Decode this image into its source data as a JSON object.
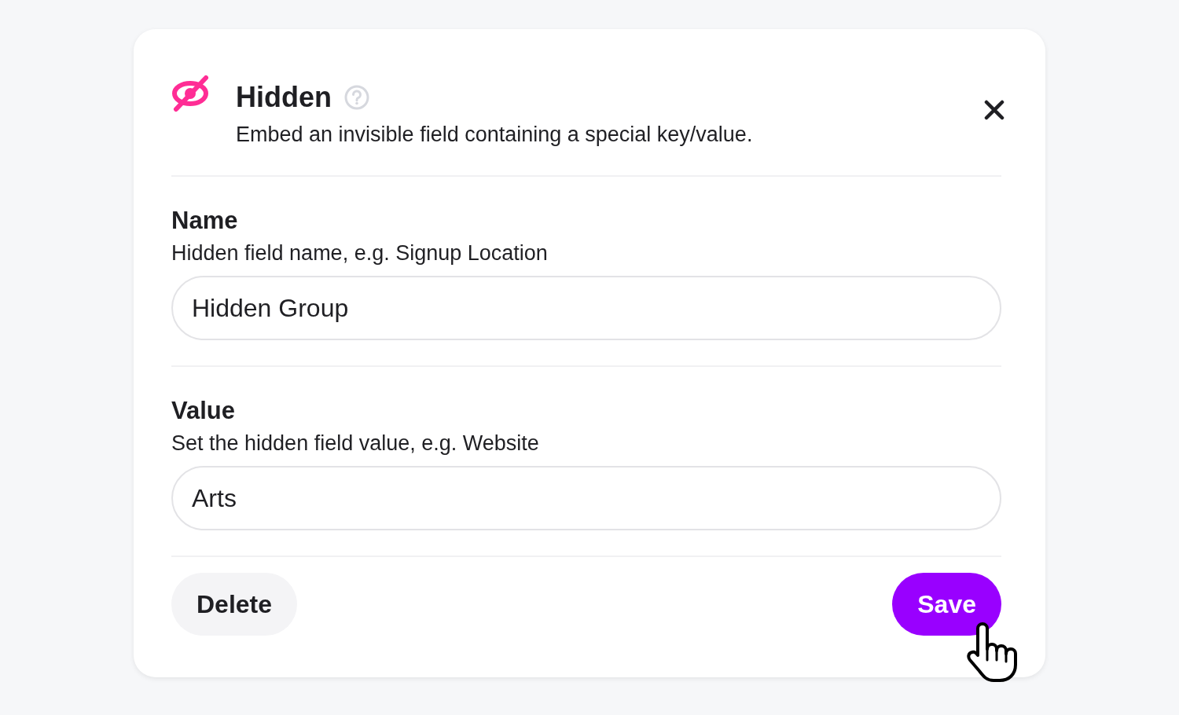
{
  "dialog": {
    "title": "Hidden",
    "description": "Embed an invisible field containing a special key/value.",
    "fields": [
      {
        "label": "Name",
        "hint": "Hidden field name, e.g. Signup Location",
        "value": "Hidden Group"
      },
      {
        "label": "Value",
        "hint": "Set the hidden field value, e.g. Website",
        "value": "Arts"
      }
    ],
    "buttons": [
      {
        "label": "Delete",
        "kind": "secondary"
      },
      {
        "label": "Save",
        "kind": "primary"
      }
    ]
  }
}
